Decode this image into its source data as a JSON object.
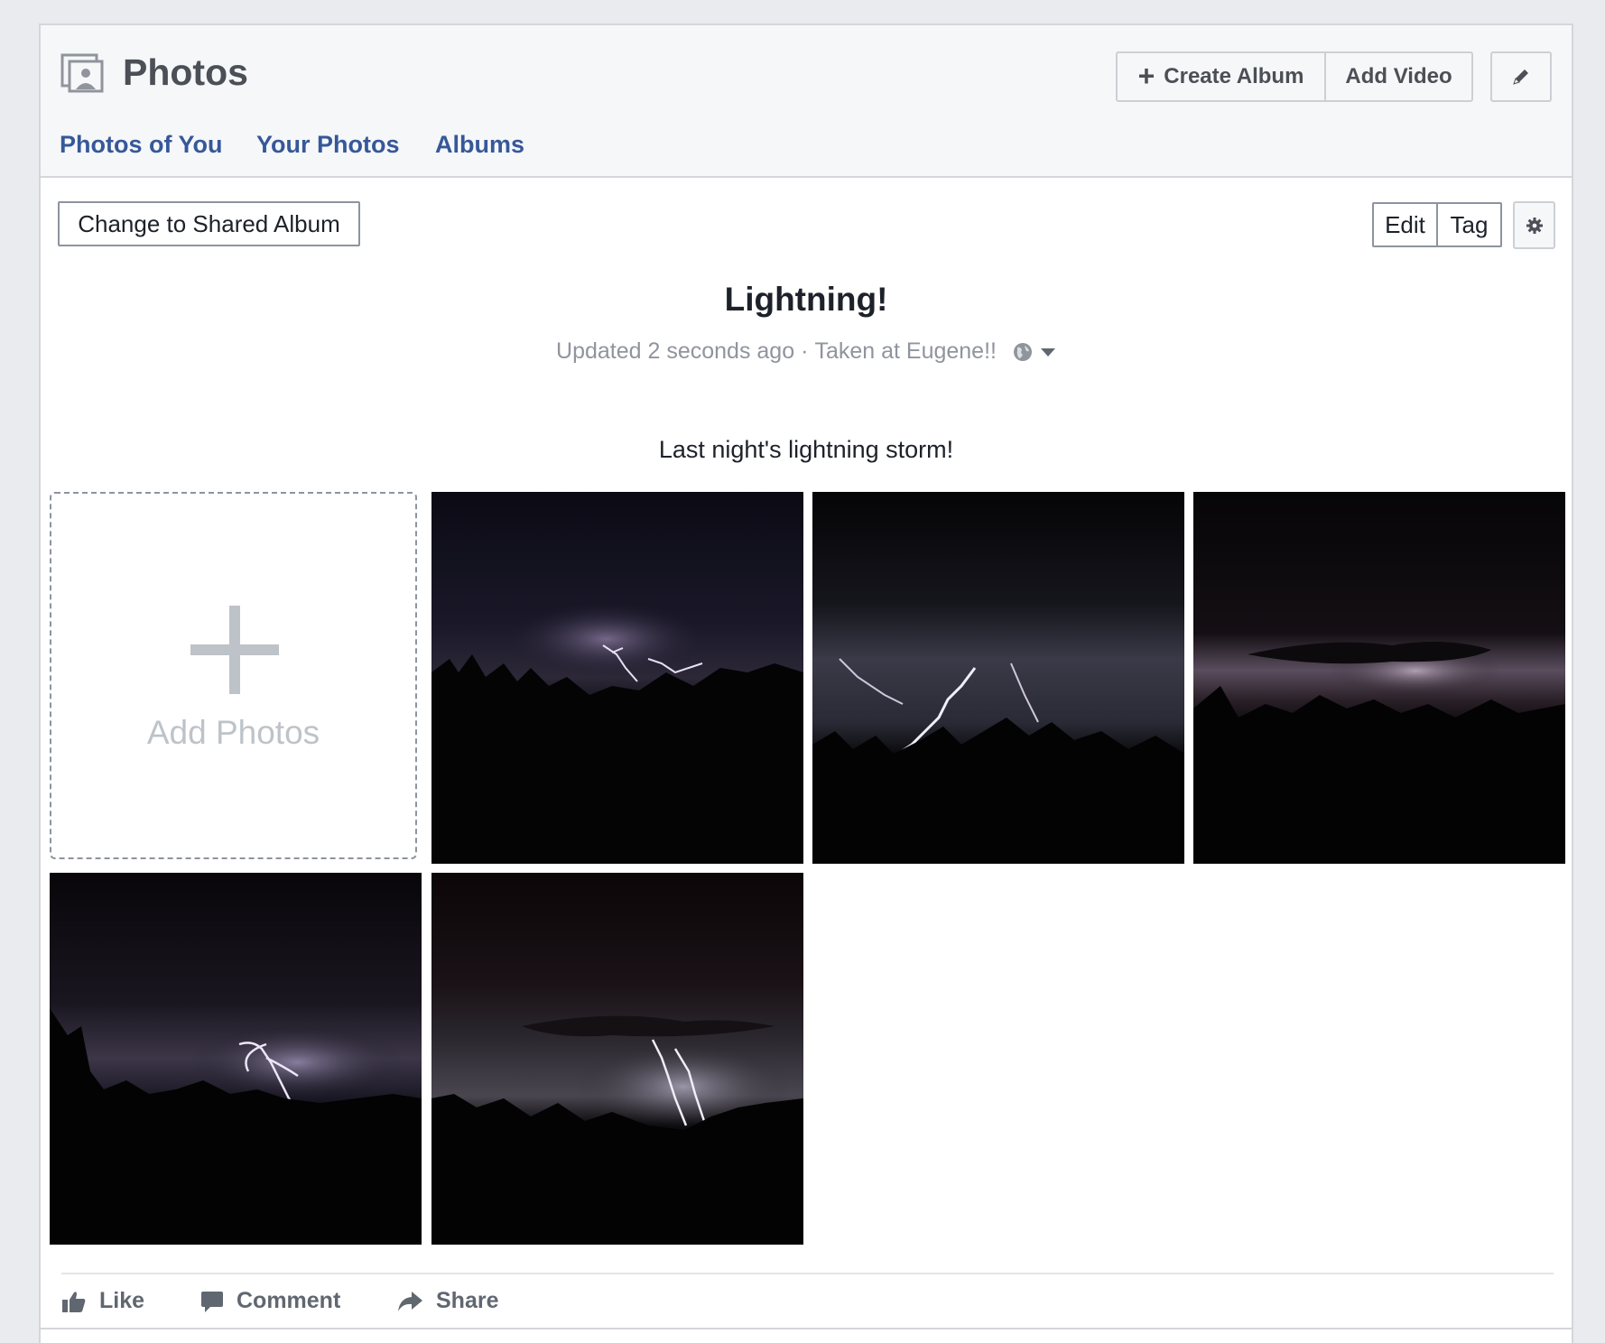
{
  "header": {
    "title": "Photos",
    "icon": "photos-icon",
    "create_album_label": "Create Album",
    "add_video_label": "Add Video",
    "edit_icon": "pencil-icon"
  },
  "tabs": [
    {
      "label": "Photos of You"
    },
    {
      "label": "Your Photos"
    },
    {
      "label": "Albums"
    }
  ],
  "album": {
    "change_shared_label": "Change to Shared Album",
    "edit_label": "Edit",
    "tag_label": "Tag",
    "settings_icon": "gear-icon",
    "title": "Lightning!",
    "updated": "Updated 2 seconds ago",
    "separator": "·",
    "location": "Taken at Eugene!!",
    "privacy_icon": "globe-icon",
    "description": "Last night's lightning storm!"
  },
  "grid": {
    "add_photos_label": "Add Photos",
    "photos": [
      {
        "alt": "lightning photo 1"
      },
      {
        "alt": "lightning photo 2"
      },
      {
        "alt": "lightning photo 3"
      },
      {
        "alt": "lightning photo 4"
      },
      {
        "alt": "lightning photo 5"
      }
    ]
  },
  "actions": {
    "like": "Like",
    "comment": "Comment",
    "share": "Share"
  },
  "colors": {
    "link": "#365899",
    "muted": "#90949c",
    "page_bg": "#e9ebee",
    "header_bg": "#f6f7f9"
  }
}
